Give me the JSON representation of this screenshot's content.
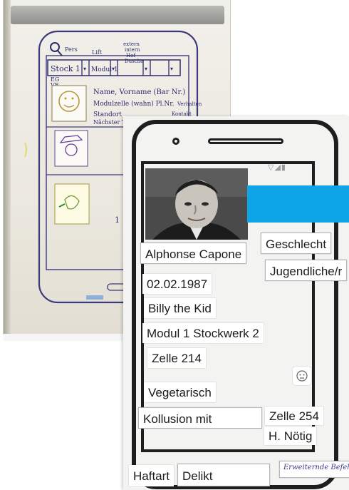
{
  "sketch": {
    "header_labels": [
      "Pers",
      "Lift",
      "extern",
      "intern",
      "Hof",
      "Dusche"
    ],
    "header_row": [
      "Stock 1",
      "Modul 1"
    ],
    "badge": [
      "EG",
      "VE"
    ],
    "lines": [
      "Name, Vorname (Bar Nr.)",
      "Modulzelle (wahn) Pl.Nr.",
      "Standort",
      "Nächster T..."
    ],
    "side_notes": [
      "Verhalten",
      "Kontakt"
    ],
    "margin_number": "1"
  },
  "prototype": {
    "statusbar": "▽◢▮",
    "name": "Alphonse Capone",
    "gender": "Geschlecht",
    "age_group": "Jugendliche/r",
    "birthdate": "02.02.1987",
    "alias": "Billy the Kid",
    "location": "Modul 1 Stockwerk 2",
    "cell": "Zelle 214",
    "diet": "Vegetarisch",
    "collusion": "Kollusion mit",
    "collusion_cell": "Zelle 254",
    "collusion_name": "H. Nötig",
    "detention_type": "Haftart",
    "offense": "Delikt",
    "note": "Erweiternde Befehle"
  },
  "colors": {
    "accent_blue": "#0ea5e6",
    "ink": "#2c2a6b",
    "frame": "#1e1e1e"
  },
  "icons": [
    "magnifier-icon",
    "dropdown-arrow-icon",
    "smiley-icon",
    "camera-icon"
  ]
}
